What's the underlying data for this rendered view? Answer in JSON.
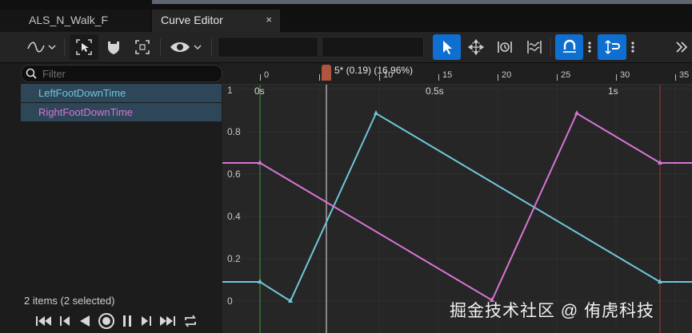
{
  "tabs": [
    {
      "label": "ALS_N_Walk_F"
    },
    {
      "label": "Curve Editor",
      "close": "×"
    }
  ],
  "toolbar": {
    "icons": [
      "curve-type-icon",
      "chevron-down-icon",
      "select-tool-icon",
      "shield-mask-icon",
      "frame-brackets-icon",
      "eye-icon",
      "chevron-down-icon",
      "pointer-icon",
      "transform-icon",
      "retime-icon",
      "multi-select-icon",
      "snap-magnet-icon",
      "snap-axis-icon",
      "more-icon"
    ]
  },
  "filter": {
    "placeholder": "Filter"
  },
  "curves": [
    {
      "label": "LeftFootDownTime",
      "color": "#6fc6da"
    },
    {
      "label": "RightFootDownTime",
      "color": "#d775d5"
    }
  ],
  "status": {
    "items_text": "2 items (2 selected)"
  },
  "ruler": {
    "frames": [
      "0",
      "5",
      "10",
      "15",
      "20",
      "25",
      "30",
      "35"
    ],
    "playhead_label": "5* (0.19) (16.96%)"
  },
  "time_labels": [
    "0s",
    "0.5s",
    "1s"
  ],
  "y_axis": [
    "1",
    "0.8",
    "0.6",
    "0.4",
    "0.2",
    "0"
  ],
  "colors": {
    "accent": "#0f6fd1",
    "start_marker": "#3e9a3e",
    "end_marker": "#a33838",
    "playhead": "#c8c8c8"
  },
  "watermark": "掘金技术社区 @ 侑虎科技"
}
